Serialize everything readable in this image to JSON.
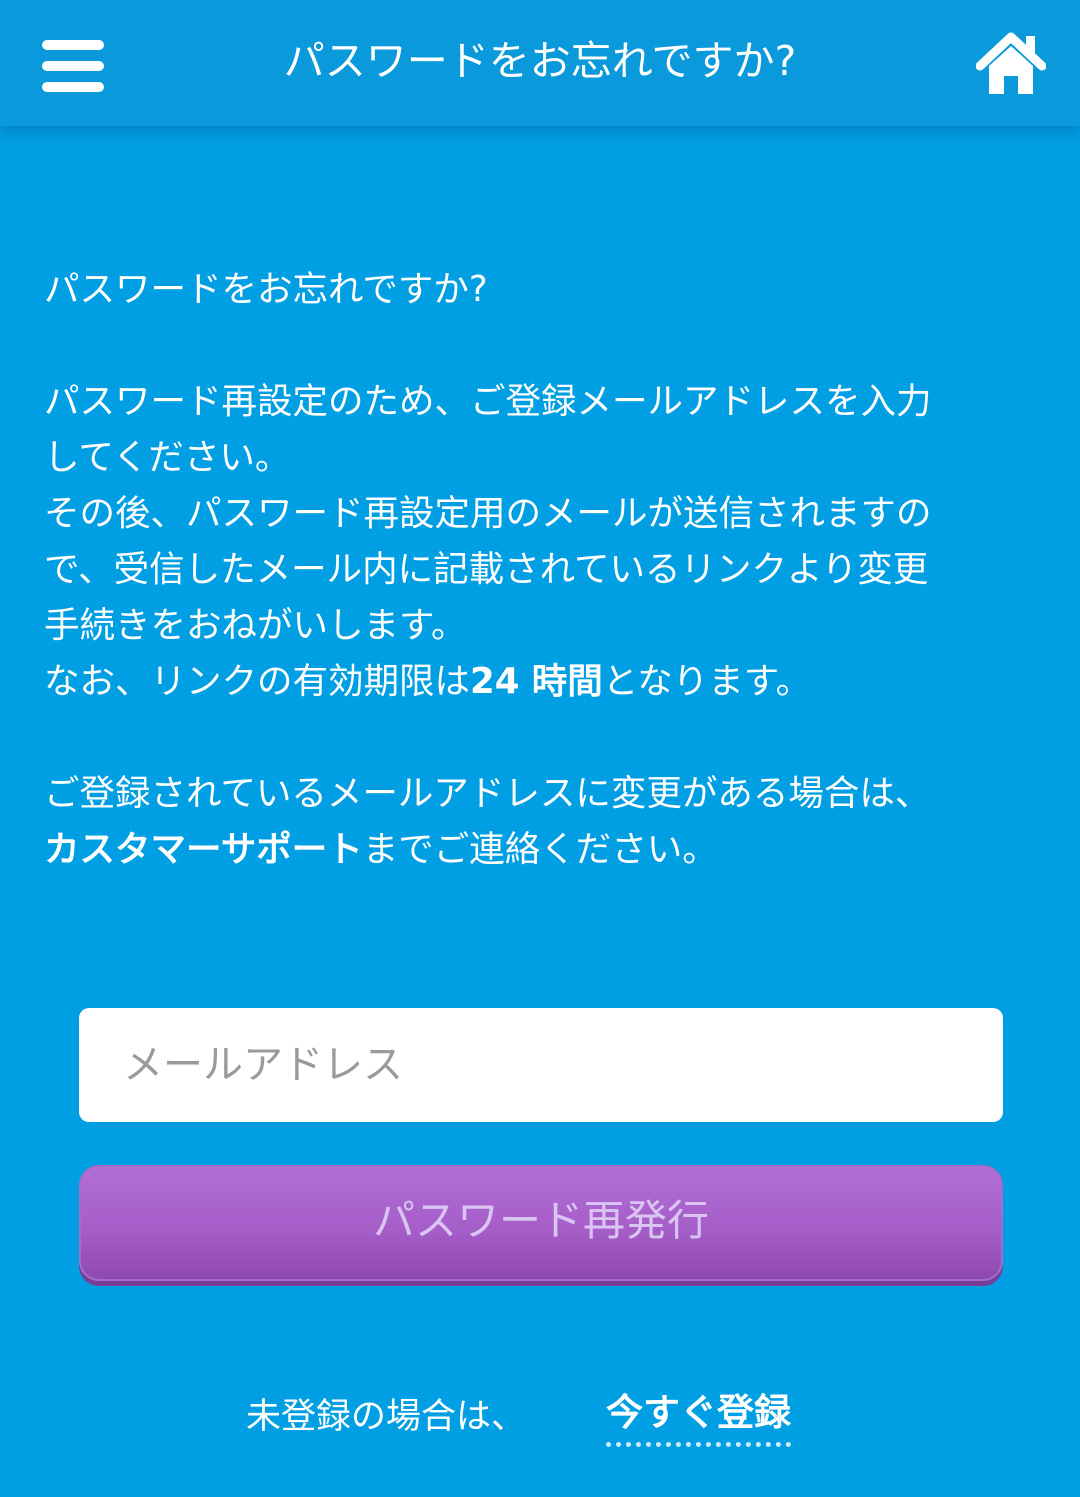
{
  "header": {
    "title": "パスワードをお忘れですか?",
    "menu_icon": "hamburger-menu-icon",
    "home_icon": "home-icon"
  },
  "content": {
    "heading": "パスワードをお忘れですか?",
    "instructions_line1": "パスワード再設定のため、ご登録メールアドレスを入力",
    "instructions_line2": "してください。",
    "instructions_line3": "その後、パスワード再設定用のメールが送信されますの",
    "instructions_line4": "で、受信したメール内に記載されているリンクより変更",
    "instructions_line5": "手続きをおねがいします。",
    "expiry_prefix": "なお、リンクの有効期限は",
    "expiry_value": "24 時間",
    "expiry_suffix": "となります。",
    "change_notice_line1": "ご登録されているメールアドレスに変更がある場合は、",
    "support_name": "カスタマーサポート",
    "change_notice_suffix": "までご連絡ください。"
  },
  "form": {
    "email_placeholder": "メールアドレス",
    "email_value": "",
    "submit_label": "パスワード再発行"
  },
  "footer": {
    "signup_prompt": "未登録の場合は、",
    "signup_link": "今すぐ登録"
  },
  "colors": {
    "background": "#009ee3",
    "header": "#0a99db",
    "button": "#a65ec9",
    "text": "#ffffff"
  }
}
